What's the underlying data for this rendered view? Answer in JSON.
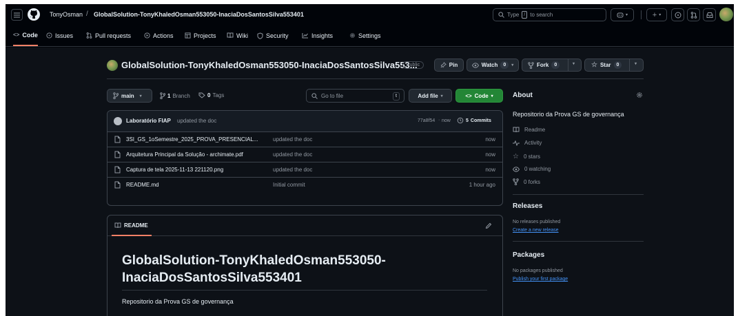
{
  "header": {
    "owner": "TonyOsman",
    "separator": "/",
    "repo": "GlobalSolution-TonyKhaledOsman553050-InaciaDosSantosSilva553401",
    "search_before": "Type",
    "search_key": "/",
    "search_after": "to search"
  },
  "nav": {
    "code": "Code",
    "issues": "Issues",
    "pulls": "Pull requests",
    "actions": "Actions",
    "projects": "Projects",
    "wiki": "Wiki",
    "security": "Security",
    "insights": "Insights",
    "settings": "Settings"
  },
  "repo": {
    "title": "GlobalSolution-TonyKhaledOsman553050-InaciaDosSantosSilva553...",
    "visibility": "Public",
    "pin": "Pin",
    "watch": "Watch",
    "watch_count": "0",
    "fork": "Fork",
    "fork_count": "0",
    "star": "Star",
    "star_count": "0"
  },
  "toolbar": {
    "branch": "main",
    "branches_count": "1",
    "branches_label": "Branch",
    "tags_count": "0",
    "tags_label": "Tags",
    "goto_placeholder": "Go to file",
    "goto_key": "t",
    "add_file": "Add file",
    "code": "Code"
  },
  "commit": {
    "author": "Laboratório FIAP",
    "message": "updated the doc",
    "hash": "77a8f54",
    "when": "now",
    "commits_count": "5",
    "commits_label": "Commits"
  },
  "files": [
    {
      "name": "3SI_GS_1oSemestre_2025_PROVA_PRESENCIAL...",
      "message": "updated the doc",
      "age": "now"
    },
    {
      "name": "Arquitetura Principal da Solução - archimate.pdf",
      "message": "updated the doc",
      "age": "now"
    },
    {
      "name": "Captura de tela 2025-11-13 221120.png",
      "message": "updated the doc",
      "age": "now"
    },
    {
      "name": "README.md",
      "message": "Initial commit",
      "age": "1 hour ago"
    }
  ],
  "readme": {
    "tab": "README",
    "title_line1": "GlobalSolution-TonyKhaledOsman553050-",
    "title_line2": "InaciaDosSantosSilva553401",
    "body": "Repositorio da Prova GS de governança"
  },
  "about": {
    "heading": "About",
    "description": "Repositorio da Prova GS de governança",
    "readme": "Readme",
    "activity": "Activity",
    "stars": "0 stars",
    "watching": "0 watching",
    "forks": "0 forks"
  },
  "releases": {
    "heading": "Releases",
    "empty": "No releases published",
    "create": "Create a new release"
  },
  "packages": {
    "heading": "Packages",
    "empty": "No packages published",
    "publish": "Publish your first package"
  },
  "colors": {
    "accent_green": "#238636",
    "link_blue": "#4493f8",
    "active_tab": "#f78166"
  }
}
